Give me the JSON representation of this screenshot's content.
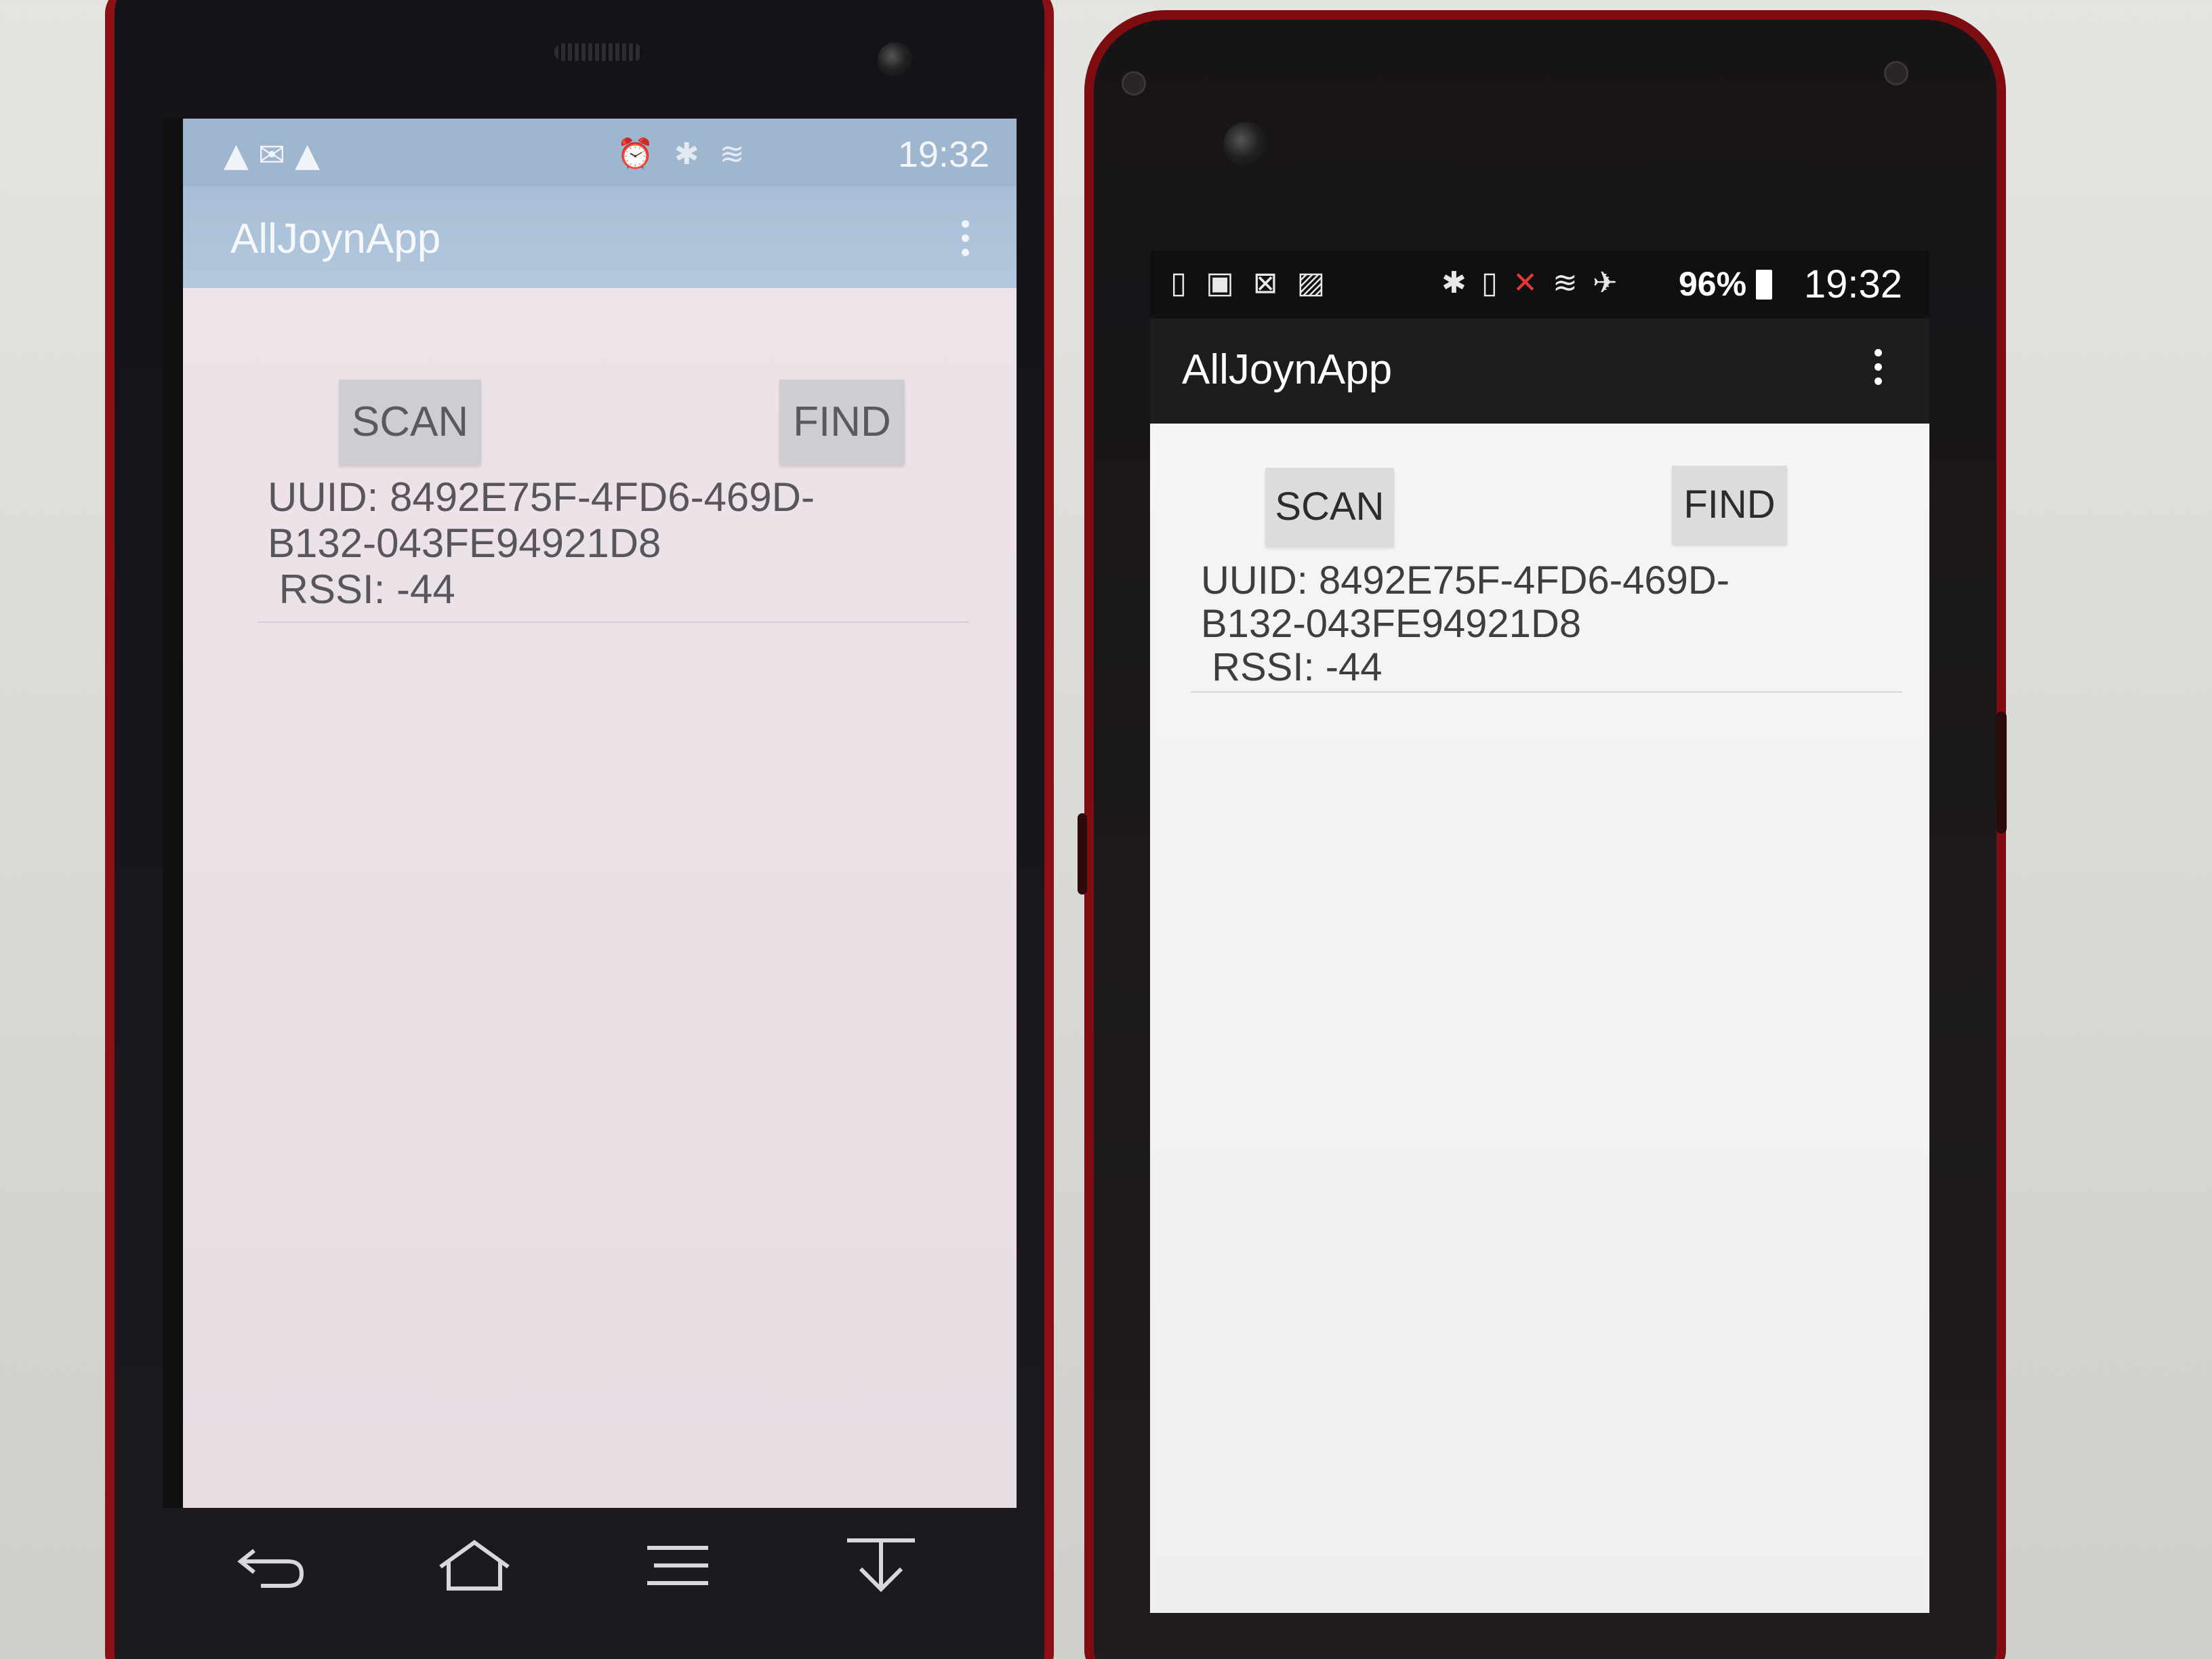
{
  "left_phone": {
    "status_bar": {
      "icons_left": [
        "warning-icon",
        "mail-icon",
        "warning-icon"
      ],
      "icons_right": [
        "alarm-icon",
        "bluetooth-icon",
        "wifi-icon"
      ],
      "time": "19:32"
    },
    "app_bar": {
      "title": "AllJoynApp",
      "menu_icon": "overflow-menu-icon"
    },
    "buttons": {
      "scan": "SCAN",
      "find": "FIND"
    },
    "result": {
      "uuid_line1": "UUID: 8492E75F-4FD6-469D-",
      "uuid_line2": "B132-043FE94921D8",
      "rssi": " RSSI: -44"
    },
    "nav_bar": [
      "back-icon",
      "home-icon",
      "menu-icon",
      "notification-pull-icon"
    ]
  },
  "right_phone": {
    "status_bar": {
      "icons_left": [
        "screen-rotate-icon",
        "photos-icon",
        "inbox-icon",
        "image-icon"
      ],
      "icons_right": [
        "bluetooth-icon",
        "vibrate-icon",
        "no-sim-icon",
        "wifi-icon",
        "airplane-icon"
      ],
      "battery": "96%",
      "time": "19:32"
    },
    "app_bar": {
      "title": "AllJoynApp",
      "menu_icon": "overflow-menu-icon"
    },
    "buttons": {
      "scan": "SCAN",
      "find": "FIND"
    },
    "result": {
      "uuid_line1": "UUID: 8492E75F-4FD6-469D-",
      "uuid_line2": "B132-043FE94921D8",
      "rssi": " RSSI: -44"
    }
  },
  "colors": {
    "phone_body_red": "#8a1015",
    "left_app_bar": "#a7bed6",
    "right_app_bar": "#1d1d1f"
  }
}
